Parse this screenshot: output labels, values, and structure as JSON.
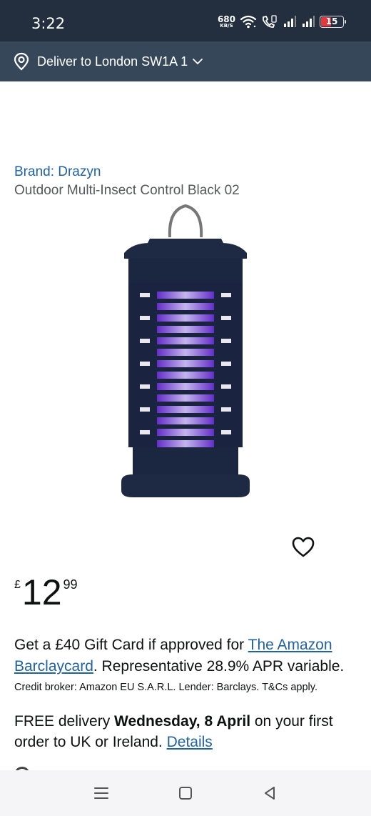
{
  "status_bar": {
    "time": "3:22",
    "net_speed_value": "680",
    "net_speed_unit": "KB/S",
    "battery_level": "15",
    "icons": [
      "wifi-icon",
      "volte-call-icon",
      "signal-bars-icon",
      "signal-bars-icon",
      "battery-icon"
    ]
  },
  "delivery_header": {
    "icon": "location-pin-icon",
    "text": "Deliver to London SW1A 1",
    "chevron": "chevron-down-icon"
  },
  "product": {
    "brand_link": "Brand: Drazyn",
    "title": "Outdoor Multi-Insect Control Black 02",
    "image_alt": "bug-zapper-lamp-image"
  },
  "price": {
    "currency": "£",
    "whole": "12",
    "fraction": "99"
  },
  "offer": {
    "text_before": "Get a £40 Gift Card if approved for ",
    "link": "The Amazon Barclaycard",
    "text_after": ". Representative 28.9% APR variable.",
    "credit_note": "Credit broker: Amazon EU S.A.R.L. Lender: Barclays. T&Cs apply."
  },
  "delivery_info": {
    "prefix": "FREE delivery ",
    "date": "Wednesday, 8 April",
    "suffix": " on your first order to UK or Ireland. ",
    "details_link": "Details"
  },
  "colors": {
    "status_bar_bg": "#232f3e",
    "deliver_bar_bg": "#37475a",
    "link_blue": "#2162a1",
    "battery_red": "#e0393e"
  },
  "nav": {
    "icons": [
      "menu-icon",
      "home-square-icon",
      "back-triangle-icon"
    ]
  }
}
